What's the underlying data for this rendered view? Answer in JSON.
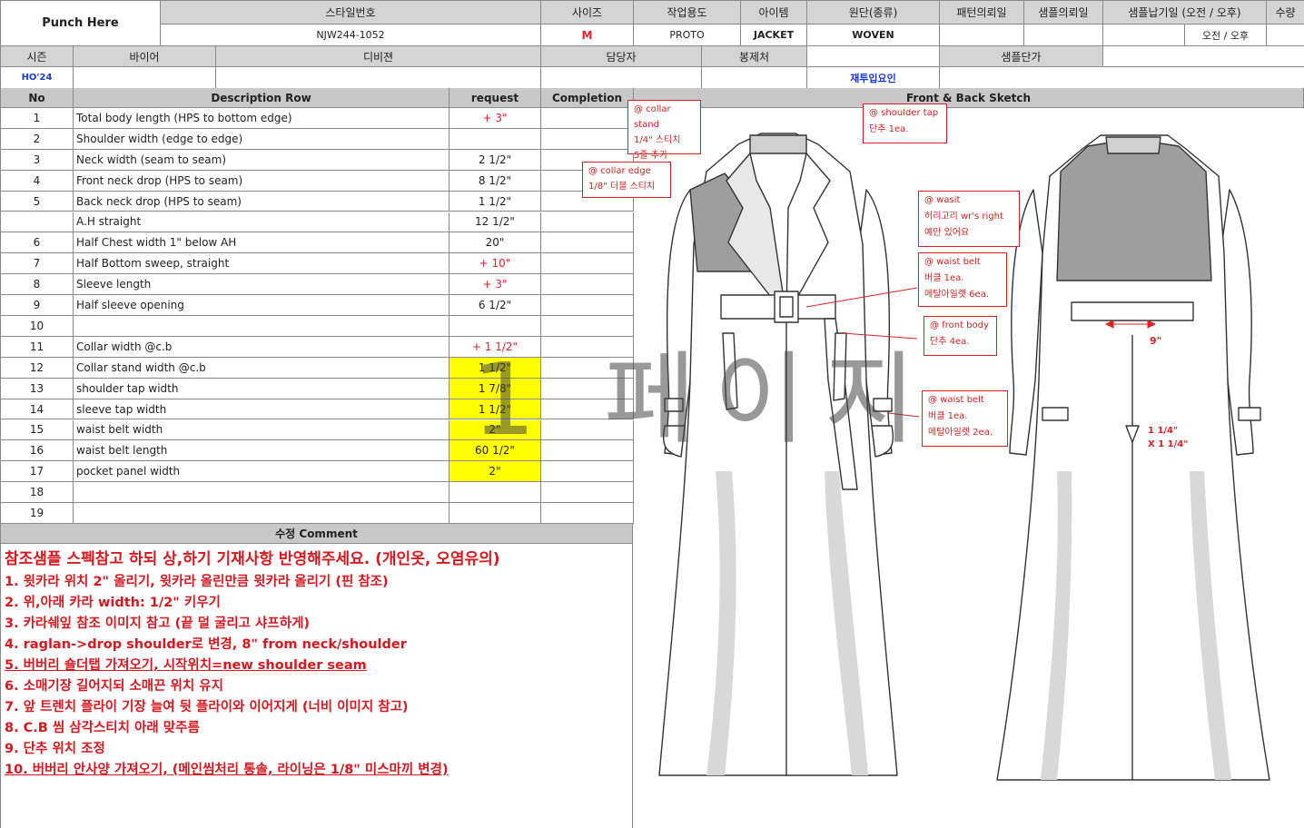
{
  "header": {
    "punch": "Punch Here",
    "style_no_label": "스타일번호",
    "style_no": "NJW244-1052",
    "size_label": "사이즈",
    "size": "M",
    "purpose_label": "작업용도",
    "purpose": "PROTO",
    "item_label": "아이템",
    "item": "JACKET",
    "fabric_label": "원단(종류)",
    "fabric": "WOVEN",
    "pattern_label": "패턴의뢰일",
    "sample_req_label": "샘플의뢰일",
    "sample_due_label": "샘플납기일 (오전 / 오후)",
    "sample_due_value": "오전  /  오후",
    "qty_label": "수량",
    "season_label": "시즌",
    "season": "HO'24",
    "buyer_label": "바이어",
    "designer_label": "디비젼",
    "manager_label": "담당자",
    "sewing_label": "봉제처",
    "sample_price_label": "샘플단가",
    "reinput_label": "재투입요인"
  },
  "table": {
    "col_no": "No",
    "col_desc": "Description Row",
    "col_request": "request",
    "col_completion": "Completion",
    "rows": [
      {
        "no": "1",
        "desc": "Total body length (HPS to bottom edge)",
        "req": "+ 3\"",
        "style": "red"
      },
      {
        "no": "2",
        "desc": "Shoulder width (edge to edge)",
        "req": "",
        "style": ""
      },
      {
        "no": "3",
        "desc": "Neck width (seam to seam)",
        "req": "2 1/2\"",
        "style": ""
      },
      {
        "no": "4",
        "desc": "Front neck drop (HPS to seam)",
        "req": "8 1/2\"",
        "style": ""
      },
      {
        "no": "5",
        "desc": "Back neck drop (HPS to seam)",
        "req": "1 1/2\"",
        "style": ""
      },
      {
        "no": "",
        "desc": "A.H straight",
        "req": "12 1/2\"",
        "style": ""
      },
      {
        "no": "6",
        "desc": "Half Chest width 1\" below AH",
        "req": "20\"",
        "style": ""
      },
      {
        "no": "7",
        "desc": "Half Bottom sweep, straight",
        "req": "+ 10\"",
        "style": "red"
      },
      {
        "no": "8",
        "desc": "Sleeve length",
        "req": "+ 3\"",
        "style": "red"
      },
      {
        "no": "9",
        "desc": "Half sleeve opening",
        "req": "6 1/2\"",
        "style": ""
      },
      {
        "no": "10",
        "desc": "",
        "req": "",
        "style": ""
      },
      {
        "no": "11",
        "desc": "Collar width @c.b",
        "req": "+ 1 1/2\"",
        "style": "red"
      },
      {
        "no": "12",
        "desc": "Collar stand width @c.b",
        "req": "1 1/2\"",
        "style": "yellow"
      },
      {
        "no": "13",
        "desc": "shoulder tap width",
        "req": "1 7/8\"",
        "style": "yellow"
      },
      {
        "no": "14",
        "desc": "sleeve tap width",
        "req": "1 1/2\"",
        "style": "yellow"
      },
      {
        "no": "15",
        "desc": "waist belt width",
        "req": "2\"",
        "style": "yellow"
      },
      {
        "no": "16",
        "desc": "waist belt length",
        "req": "60 1/2\"",
        "style": "yellow"
      },
      {
        "no": "17",
        "desc": "pocket panel width",
        "req": "2\"",
        "style": "yellow"
      },
      {
        "no": "18",
        "desc": "",
        "req": "",
        "style": ""
      },
      {
        "no": "19",
        "desc": "",
        "req": "",
        "style": ""
      }
    ]
  },
  "sketch_title": "Front & Back Sketch",
  "comment_title": "수정 Comment",
  "comments": [
    {
      "text": "참조샘플 스펙참고 하되 상,하기 기재사항 반영해주세요. (개인옷, 오염유의)",
      "underline": false
    },
    {
      "text": "1. 윗카라 위치 2\" 올리기, 윗카라 올린만큼 윗카라 올리기 (핀 참조)",
      "underline": false
    },
    {
      "text": "2. 위,아래 카라 width: 1/2\" 키우기",
      "underline": false
    },
    {
      "text": "3. 카라쉐잎 참조 이미지 참고 (끝 덜 굴리고 샤프하게)",
      "underline": false
    },
    {
      "text": "4. raglan->drop shoulder로 변경, 8\" from neck/shoulder",
      "underline": false
    },
    {
      "text": "5. 버버리 숄더탭 가져오기, 시작위치=new shoulder seam",
      "underline": true
    },
    {
      "text": "6. 소매기장 길어지되 소매끈 위치 유지",
      "underline": false
    },
    {
      "text": "7. 앞 트렌치 플라이 기장 늘여 뒷 플라이와 이어지게 (너비 이미지 참고)",
      "underline": false
    },
    {
      "text": "8. C.B 씸 삼각스티치 아래 맞주름",
      "underline": false
    },
    {
      "text": "9. 단추 위치 조정",
      "underline": false
    },
    {
      "text": "10. 버버리 안사양 가져오기, (메인씸처리 통솔, 라이닝은 1/8\" 미스마끼 변경)",
      "underline": true
    }
  ],
  "notes": {
    "collar_stand": [
      "@ collar stand",
      "1/4\" 스티치",
      "5줄 추가"
    ],
    "collar_edge": [
      "@ collar edge",
      "1/8\" 더블 스티치"
    ],
    "shoulder_tap": [
      "@ shoulder tap",
      "단추 1ea."
    ],
    "waist": [
      "@ wasit",
      "허리고리 wr's right",
      "예만 있어요"
    ],
    "waist_belt_1": [
      "@ waist belt",
      "버클 1ea.",
      "메탈아일렛 6ea."
    ],
    "front_body": [
      "@ front body",
      "단추 4ea."
    ],
    "waist_belt_2": [
      "@ waist belt",
      "버클 1ea.",
      "메탈아일렛 2ea."
    ]
  },
  "measure_labels": {
    "back_belt": "9\"",
    "cb_pleat_1": "1 1/4\"",
    "cb_pleat_2": "X 1 1/4\""
  },
  "watermark": "1 페이지"
}
